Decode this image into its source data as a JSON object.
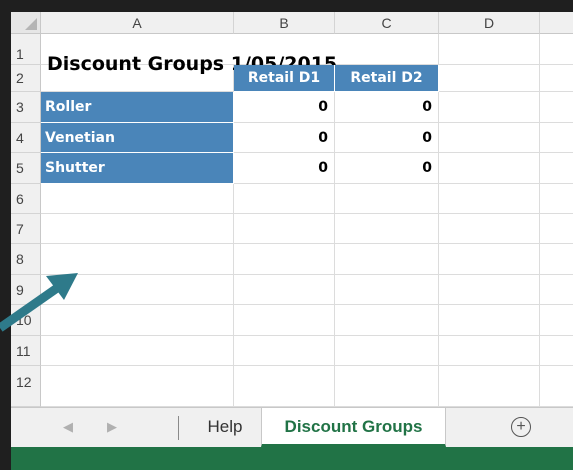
{
  "spreadsheet": {
    "columns": [
      "A",
      "B",
      "C",
      "D"
    ],
    "rows": [
      "1",
      "2",
      "3",
      "4",
      "5",
      "6",
      "7",
      "8",
      "9",
      "10",
      "11",
      "12"
    ],
    "title_cell": "Discount Groups 1/05/2015",
    "headers": [
      "Retail D1",
      "Retail D2"
    ],
    "data_rows": [
      {
        "label": "Roller",
        "d1": "0",
        "d2": "0"
      },
      {
        "label": "Venetian",
        "d1": "0",
        "d2": "0"
      },
      {
        "label": "Shutter",
        "d1": "0",
        "d2": "0"
      }
    ]
  },
  "sheet_tabs": {
    "tabs": [
      "Help",
      "Discount Groups"
    ],
    "active": "Discount Groups",
    "nav_left": "◀",
    "nav_right": "▶",
    "add": "+"
  },
  "colors": {
    "header_fill": "#4a85b9",
    "status_bar": "#217346",
    "annotation_arrow": "#2e7a8a"
  }
}
